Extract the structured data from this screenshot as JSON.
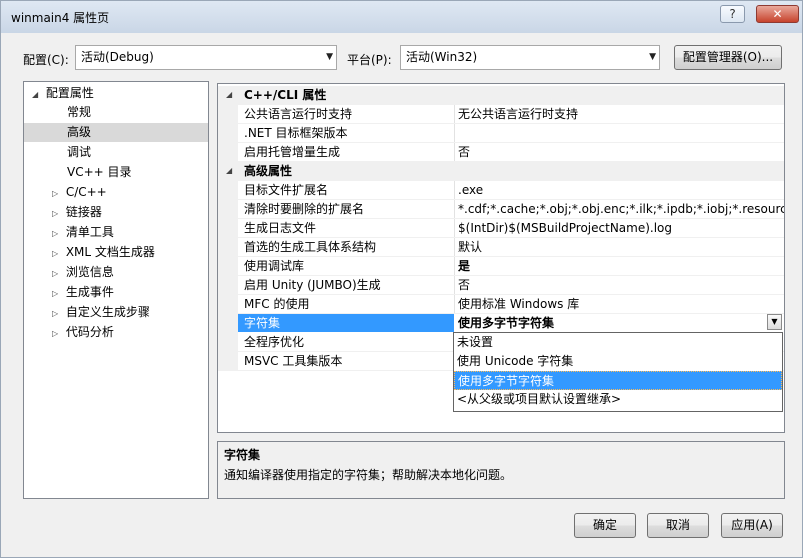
{
  "window": {
    "title": "winmain4 属性页",
    "help_btn": "?",
    "min_btn": "–",
    "close_btn": "✕"
  },
  "header": {
    "config_label": "配置(C):",
    "config_value": "活动(Debug)",
    "platform_label": "平台(P):",
    "platform_value": "活动(Win32)",
    "config_manager_button": "配置管理器(O)..."
  },
  "tree": {
    "root": "配置属性",
    "items": [
      {
        "label": "常规",
        "expandable": false,
        "selected": false
      },
      {
        "label": "高级",
        "expandable": false,
        "selected": true
      },
      {
        "label": "调试",
        "expandable": false,
        "selected": false
      },
      {
        "label": "VC++ 目录",
        "expandable": false,
        "selected": false
      },
      {
        "label": "C/C++",
        "expandable": true,
        "selected": false
      },
      {
        "label": "链接器",
        "expandable": true,
        "selected": false
      },
      {
        "label": "清单工具",
        "expandable": true,
        "selected": false
      },
      {
        "label": "XML 文档生成器",
        "expandable": true,
        "selected": false
      },
      {
        "label": "浏览信息",
        "expandable": true,
        "selected": false
      },
      {
        "label": "生成事件",
        "expandable": true,
        "selected": false
      },
      {
        "label": "自定义生成步骤",
        "expandable": true,
        "selected": false
      },
      {
        "label": "代码分析",
        "expandable": true,
        "selected": false
      }
    ]
  },
  "grid": {
    "cat1": "C++/CLI 属性",
    "cat1_rows": [
      {
        "name": "公共语言运行时支持",
        "value": "无公共语言运行时支持"
      },
      {
        "name": ".NET 目标框架版本",
        "value": ""
      },
      {
        "name": "启用托管增量生成",
        "value": "否"
      }
    ],
    "cat2": "高级属性",
    "cat2_rows": [
      {
        "name": "目标文件扩展名",
        "value": ".exe"
      },
      {
        "name": "清除时要删除的扩展名",
        "value": "*.cdf;*.cache;*.obj;*.obj.enc;*.ilk;*.ipdb;*.iobj;*.resources;*.tlb"
      },
      {
        "name": "生成日志文件",
        "value": "$(IntDir)$(MSBuildProjectName).log"
      },
      {
        "name": "首选的生成工具体系结构",
        "value": "默认"
      },
      {
        "name": "使用调试库",
        "value": "是"
      },
      {
        "name": "启用 Unity (JUMBO)生成",
        "value": "否"
      },
      {
        "name": "MFC 的使用",
        "value": "使用标准 Windows 库"
      },
      {
        "name": "字符集",
        "value": "使用多字节字符集"
      },
      {
        "name": "全程序优化",
        "value": ""
      },
      {
        "name": "MSVC 工具集版本",
        "value": ""
      }
    ],
    "dropdown_options": [
      "未设置",
      "使用 Unicode 字符集",
      "使用多字节字符集",
      "<从父级或项目默认设置继承>"
    ]
  },
  "description": {
    "title": "字符集",
    "text": "通知编译器使用指定的字符集；帮助解决本地化问题。"
  },
  "footer": {
    "ok": "确定",
    "cancel": "取消",
    "apply": "应用(A)"
  },
  "colors": {
    "selection": "#3399ff",
    "tree_selection": "#d9d9d9"
  }
}
